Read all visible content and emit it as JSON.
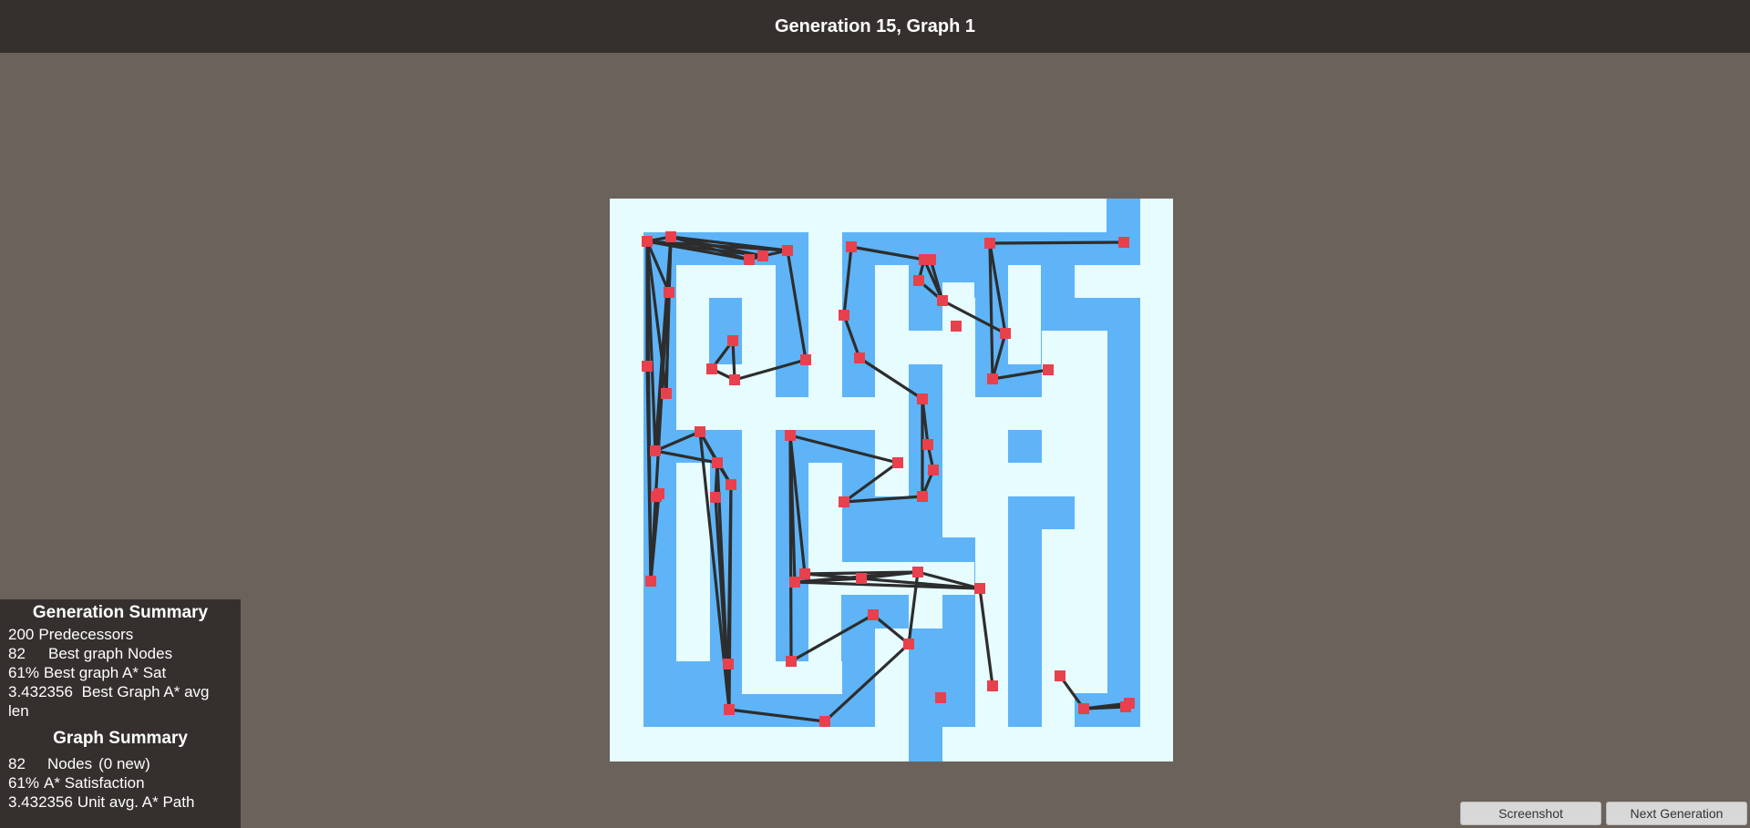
{
  "title": "Generation 15, Graph 1",
  "colors": {
    "background": "#6b625c",
    "header": "#35302e",
    "maze_floor": "#e6fcff",
    "maze_region": "#5eb4f7",
    "node": "#e8404d",
    "edge": "#2d2d2d"
  },
  "generation_summary": {
    "heading": "Generation Summary",
    "rows": [
      {
        "value": "200",
        "label": "Predecessors"
      },
      {
        "value": "82",
        "label": "Best graph Nodes"
      },
      {
        "value": "61%",
        "label": "Best graph A* Sat"
      },
      {
        "value": "3.432356",
        "label": "Best Graph A* avg len"
      }
    ]
  },
  "graph_summary": {
    "heading": "Graph Summary",
    "nodes_value": "82",
    "nodes_label": "Nodes",
    "nodes_new": "(0 new)",
    "sat_value": "61%",
    "sat_label": "A* Satisfaction",
    "path_value": "3.432356",
    "path_label": "Unit avg. A* Path"
  },
  "buttons": {
    "screenshot": "Screenshot",
    "next_generation": "Next Generation"
  }
}
